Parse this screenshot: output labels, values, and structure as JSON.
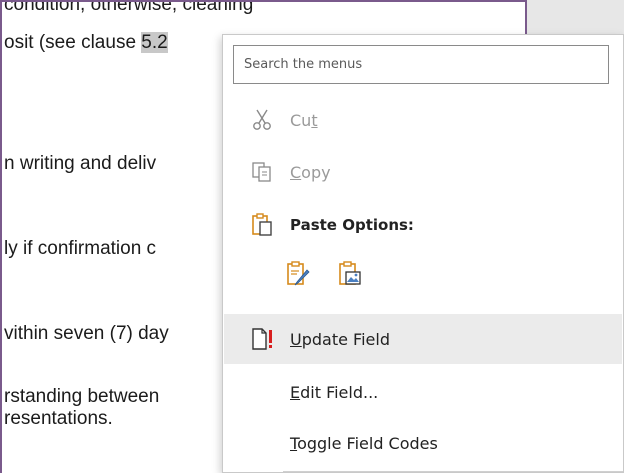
{
  "document": {
    "lines": [
      {
        "pre": "condition, otherwise, cleaning",
        "hl": "",
        "post": ""
      },
      {
        "pre": "osit (see clause ",
        "hl": "5.2",
        "post": ""
      },
      {
        "pre": "n writing and deliv",
        "hl": "",
        "post": ""
      },
      {
        "pre": "ly if confirmation c",
        "hl": "",
        "post": ""
      },
      {
        "pre": "vithin seven (7) day",
        "hl": "",
        "post": ""
      },
      {
        "pre": "rstanding between",
        "hl": "",
        "post": ""
      },
      {
        "pre": "resentations.",
        "hl": "",
        "post": ""
      }
    ]
  },
  "menu": {
    "search_placeholder": "Search the menus",
    "cut": {
      "before": "Cu",
      "accel": "t",
      "after": ""
    },
    "copy": {
      "before": "",
      "accel": "C",
      "after": "opy"
    },
    "paste_options_label": "Paste Options:",
    "update_field": {
      "before": "",
      "accel": "U",
      "after": "pdate Field"
    },
    "edit_field": {
      "before": "",
      "accel": "E",
      "after": "dit Field..."
    },
    "toggle_field_codes": {
      "before": "",
      "accel": "T",
      "after": "oggle Field Codes"
    }
  },
  "colors": {
    "accent_orange": "#d68a1c",
    "update_red": "#d81e1e",
    "hover_bg": "#ebebeb"
  }
}
